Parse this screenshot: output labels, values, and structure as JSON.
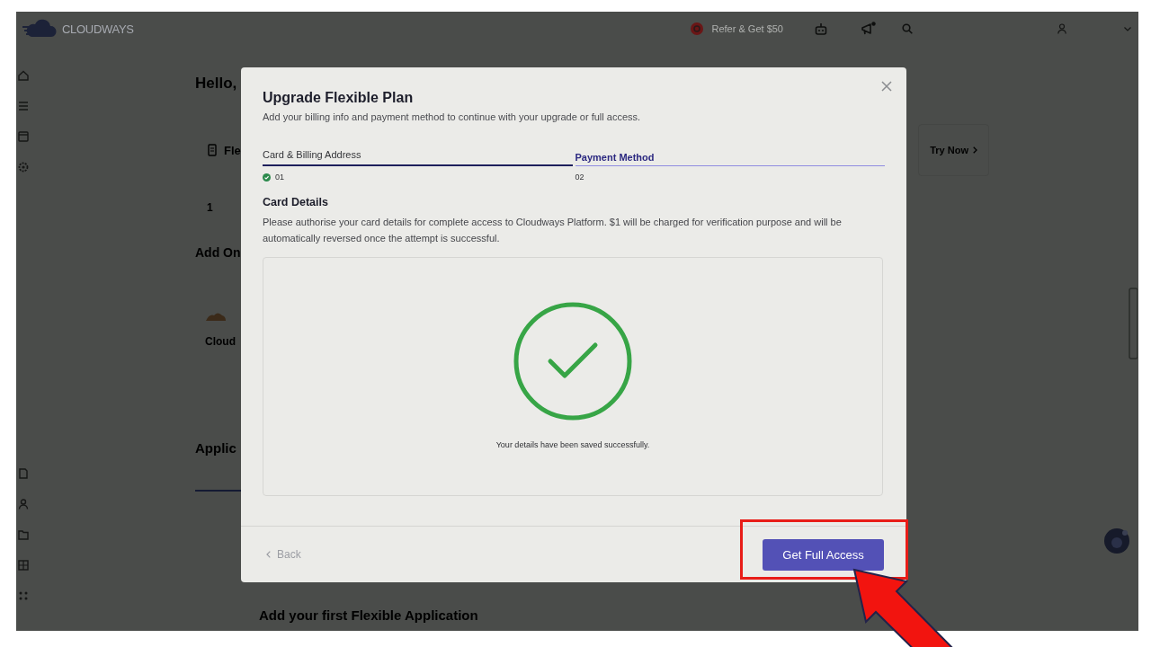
{
  "topbar": {
    "logo": "CLOUDWAYS",
    "referral": "Refer & Get $50"
  },
  "page": {
    "greeting": "Hello,",
    "plan_card": {
      "title": "Fle",
      "count": "1",
      "action": "Try Now"
    },
    "addons_heading": "Add On",
    "addon_card": {
      "title": "Cloud"
    },
    "applications_heading": "Applic",
    "empty_state_title": "Add your first Flexible Application"
  },
  "modal": {
    "title": "Upgrade Flexible Plan",
    "subtitle": "Add your billing info and payment method to continue with your upgrade or full access.",
    "steps": [
      {
        "label": "Card & Billing Address",
        "number": "01",
        "completed": true,
        "selected": false
      },
      {
        "label": "Payment Method",
        "number": "02",
        "completed": false,
        "selected": true
      }
    ],
    "section_title": "Card Details",
    "section_text": "Please authorise your card details for complete access to Cloudways Platform. $1 will be charged for verification purpose and will be automatically reversed once the attempt is successful.",
    "success_message": "Your details have been saved successfully.",
    "back_button": {
      "label": "Back",
      "disabled": true
    },
    "primary_button": {
      "label": "Get Full Access"
    }
  }
}
